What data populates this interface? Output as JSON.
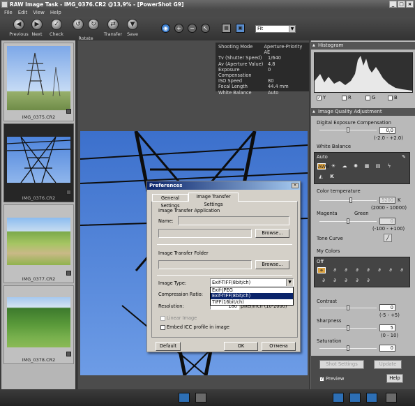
{
  "window": {
    "title": "RAW Image Task - IMG_0376.CR2 @13,9% - [PowerShot G9]"
  },
  "menu": [
    "File",
    "Edit",
    "View",
    "Help"
  ],
  "toolbar": {
    "previous": "Previous",
    "next": "Next",
    "check": "Check",
    "rotate": "Rotate",
    "transfer": "Transfer",
    "save": "Save",
    "zoom_value": "Fit"
  },
  "thumbnails": [
    {
      "caption": "IMG_0375.CR2"
    },
    {
      "caption": "IMG_0376.CR2"
    },
    {
      "caption": "IMG_0377.CR2"
    },
    {
      "caption": "IMG_0378.CR2"
    }
  ],
  "shooting_info": [
    {
      "key": "Shooting Mode",
      "value": "Aperture-Priority AE"
    },
    {
      "key": "Tv (Shutter Speed)",
      "value": "1/640"
    },
    {
      "key": "Av (Aperture Value)",
      "value": "4.8"
    },
    {
      "key": "Exposure Compensation",
      "value": "0"
    },
    {
      "key": "ISO Speed",
      "value": "80"
    },
    {
      "key": "Focal Length",
      "value": "44.4 mm"
    },
    {
      "key": "White Balance",
      "value": "Auto"
    }
  ],
  "histogram": {
    "title": "Histogram",
    "channels": [
      "Y",
      "R",
      "G",
      "B"
    ]
  },
  "iqa": {
    "title": "Image Quality Adjustment",
    "exposure_label": "Digital Exposure Compensation",
    "exposure_value": "0,0",
    "exposure_range": "(-2.0 - +2.0)",
    "wb_label": "White Balance",
    "wb_mode": "Auto",
    "wb_kelvin_letter": "K",
    "color_temp_label": "Color temperature",
    "color_temp_value": "5200",
    "color_temp_unit": "K",
    "color_temp_range": "(2000 - 10000)",
    "magenta_label": "Magenta",
    "green_label": "Green",
    "mg_value": "0",
    "mg_range": "(-100 - +100)",
    "tone_curve_label": "Tone Curve",
    "mycolors_label": "My Colors",
    "mycolors_value": "Off",
    "contrast_label": "Contrast",
    "contrast_value": "0",
    "contrast_range": "(-5 - +5)",
    "sharpness_label": "Sharpness",
    "sharpness_value": "5",
    "sharpness_range": "(0 - 10)",
    "saturation_label": "Saturation",
    "saturation_value": "0",
    "shot_settings": "Shot Settings",
    "update": "Update",
    "preview": "Preview",
    "help": "Help"
  },
  "dialog": {
    "title": "Preferences",
    "tab_general": "General Settings",
    "tab_transfer": "Image Transfer Settings",
    "app_section": "Image Transfer Application",
    "name_label": "Name:",
    "browse1": "Browse...",
    "folder_section": "Image Transfer Folder",
    "browse2": "Browse...",
    "image_type_label": "Image Type:",
    "image_type_value": "Exif-TIFF(8bit/ch)",
    "image_type_options": [
      "Exif-JPEG",
      "Exif-TIFF(8bit/ch)",
      "TIFF(16bit/ch)"
    ],
    "compression_label": "Compression Ratio:",
    "resolution_label": "Resolution:",
    "resolution_value": "180",
    "resolution_unit": "pixel/inch (10-2000)",
    "linear_label": "Linear Image",
    "icc_label": "Embed ICC profile in image",
    "default": "Default",
    "ok": "OK",
    "cancel": "Отмена"
  }
}
